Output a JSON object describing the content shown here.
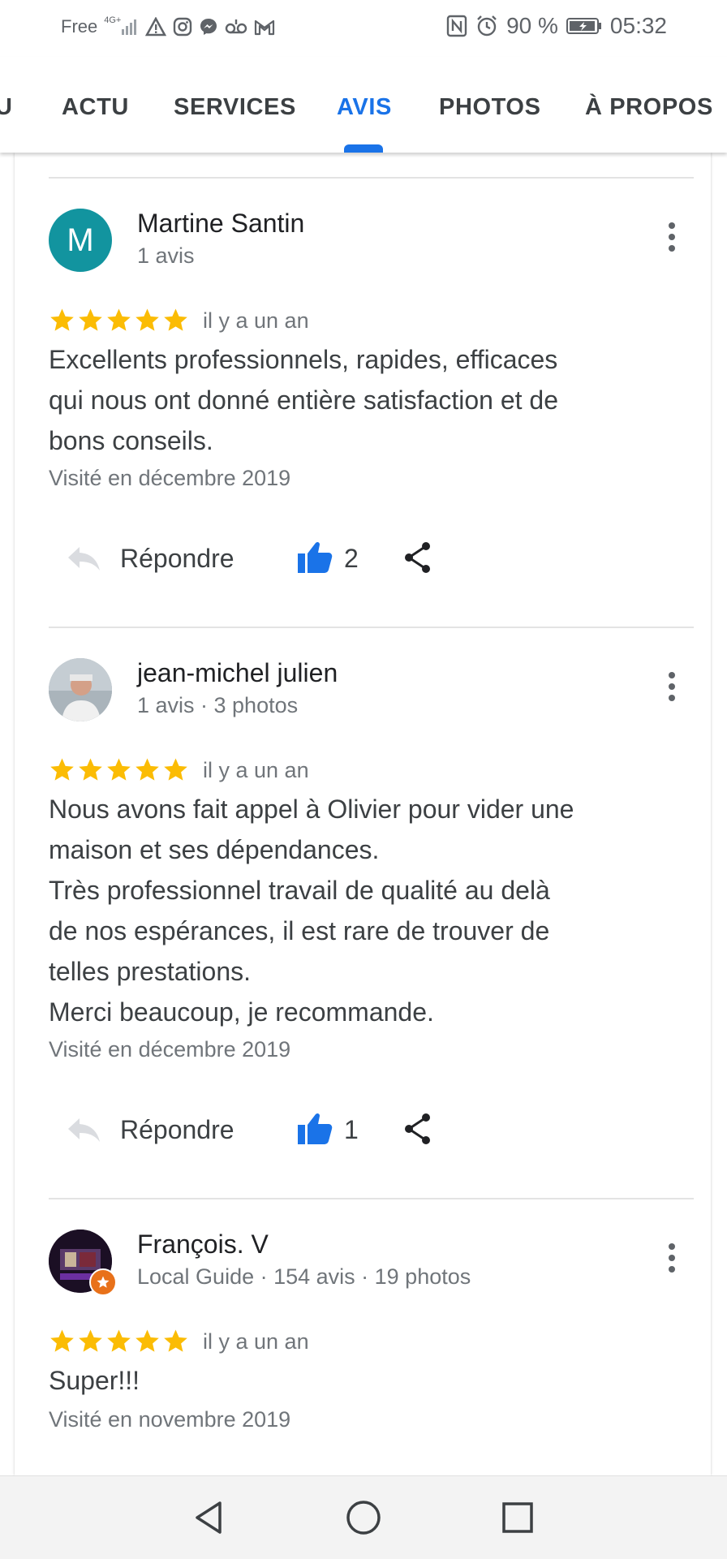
{
  "status_bar": {
    "carrier": "Free",
    "network": "4G+",
    "battery": "90 %",
    "time": "05:32",
    "left_icons": [
      "signal-icon",
      "warning-icon",
      "instagram-icon",
      "messenger-icon",
      "voicemail-icon",
      "gmail-icon"
    ],
    "right_icons": [
      "nfc-icon",
      "alarm-icon",
      "battery-icon"
    ]
  },
  "tabs": [
    {
      "label": "U"
    },
    {
      "label": "ACTU"
    },
    {
      "label": "SERVICES"
    },
    {
      "label": "AVIS",
      "active": true
    },
    {
      "label": "PHOTOS"
    },
    {
      "label": "À PROPOS"
    }
  ],
  "colors": {
    "accent": "#1a73e8",
    "star": "#fbbc04",
    "avatar_m": "#12949f"
  },
  "reviews": [
    {
      "avatar_letter": "M",
      "author": "Martine Santin",
      "meta": "1 avis",
      "rating": 5,
      "time": "il y a un an",
      "text_lines": [
        "Excellents professionnels, rapides, efficaces",
        "qui nous ont donné entière satisfaction et de",
        "bons conseils."
      ],
      "visited": "Visité en décembre 2019",
      "reply_label": "Répondre",
      "likes": "2"
    },
    {
      "author": "jean-michel julien",
      "meta": "1 avis · 3 photos",
      "rating": 5,
      "time": "il y a un an",
      "text_lines": [
        "Nous avons fait appel à Olivier  pour vider une",
        "maison et ses dépendances.",
        "Très professionnel travail de qualité au delà",
        "de nos espérances, il est rare de trouver de",
        "telles prestations.",
        "Merci beaucoup, je recommande."
      ],
      "visited": "Visité en décembre 2019",
      "reply_label": "Répondre",
      "likes": "1"
    },
    {
      "author": "François. V",
      "meta": "Local Guide · 154 avis · 19 photos",
      "rating": 5,
      "time": "il y a un an",
      "text_lines": [
        "Super!!!"
      ],
      "visited": "Visité en novembre 2019"
    }
  ],
  "nav_buttons": [
    "back-icon",
    "home-icon",
    "recents-icon"
  ]
}
